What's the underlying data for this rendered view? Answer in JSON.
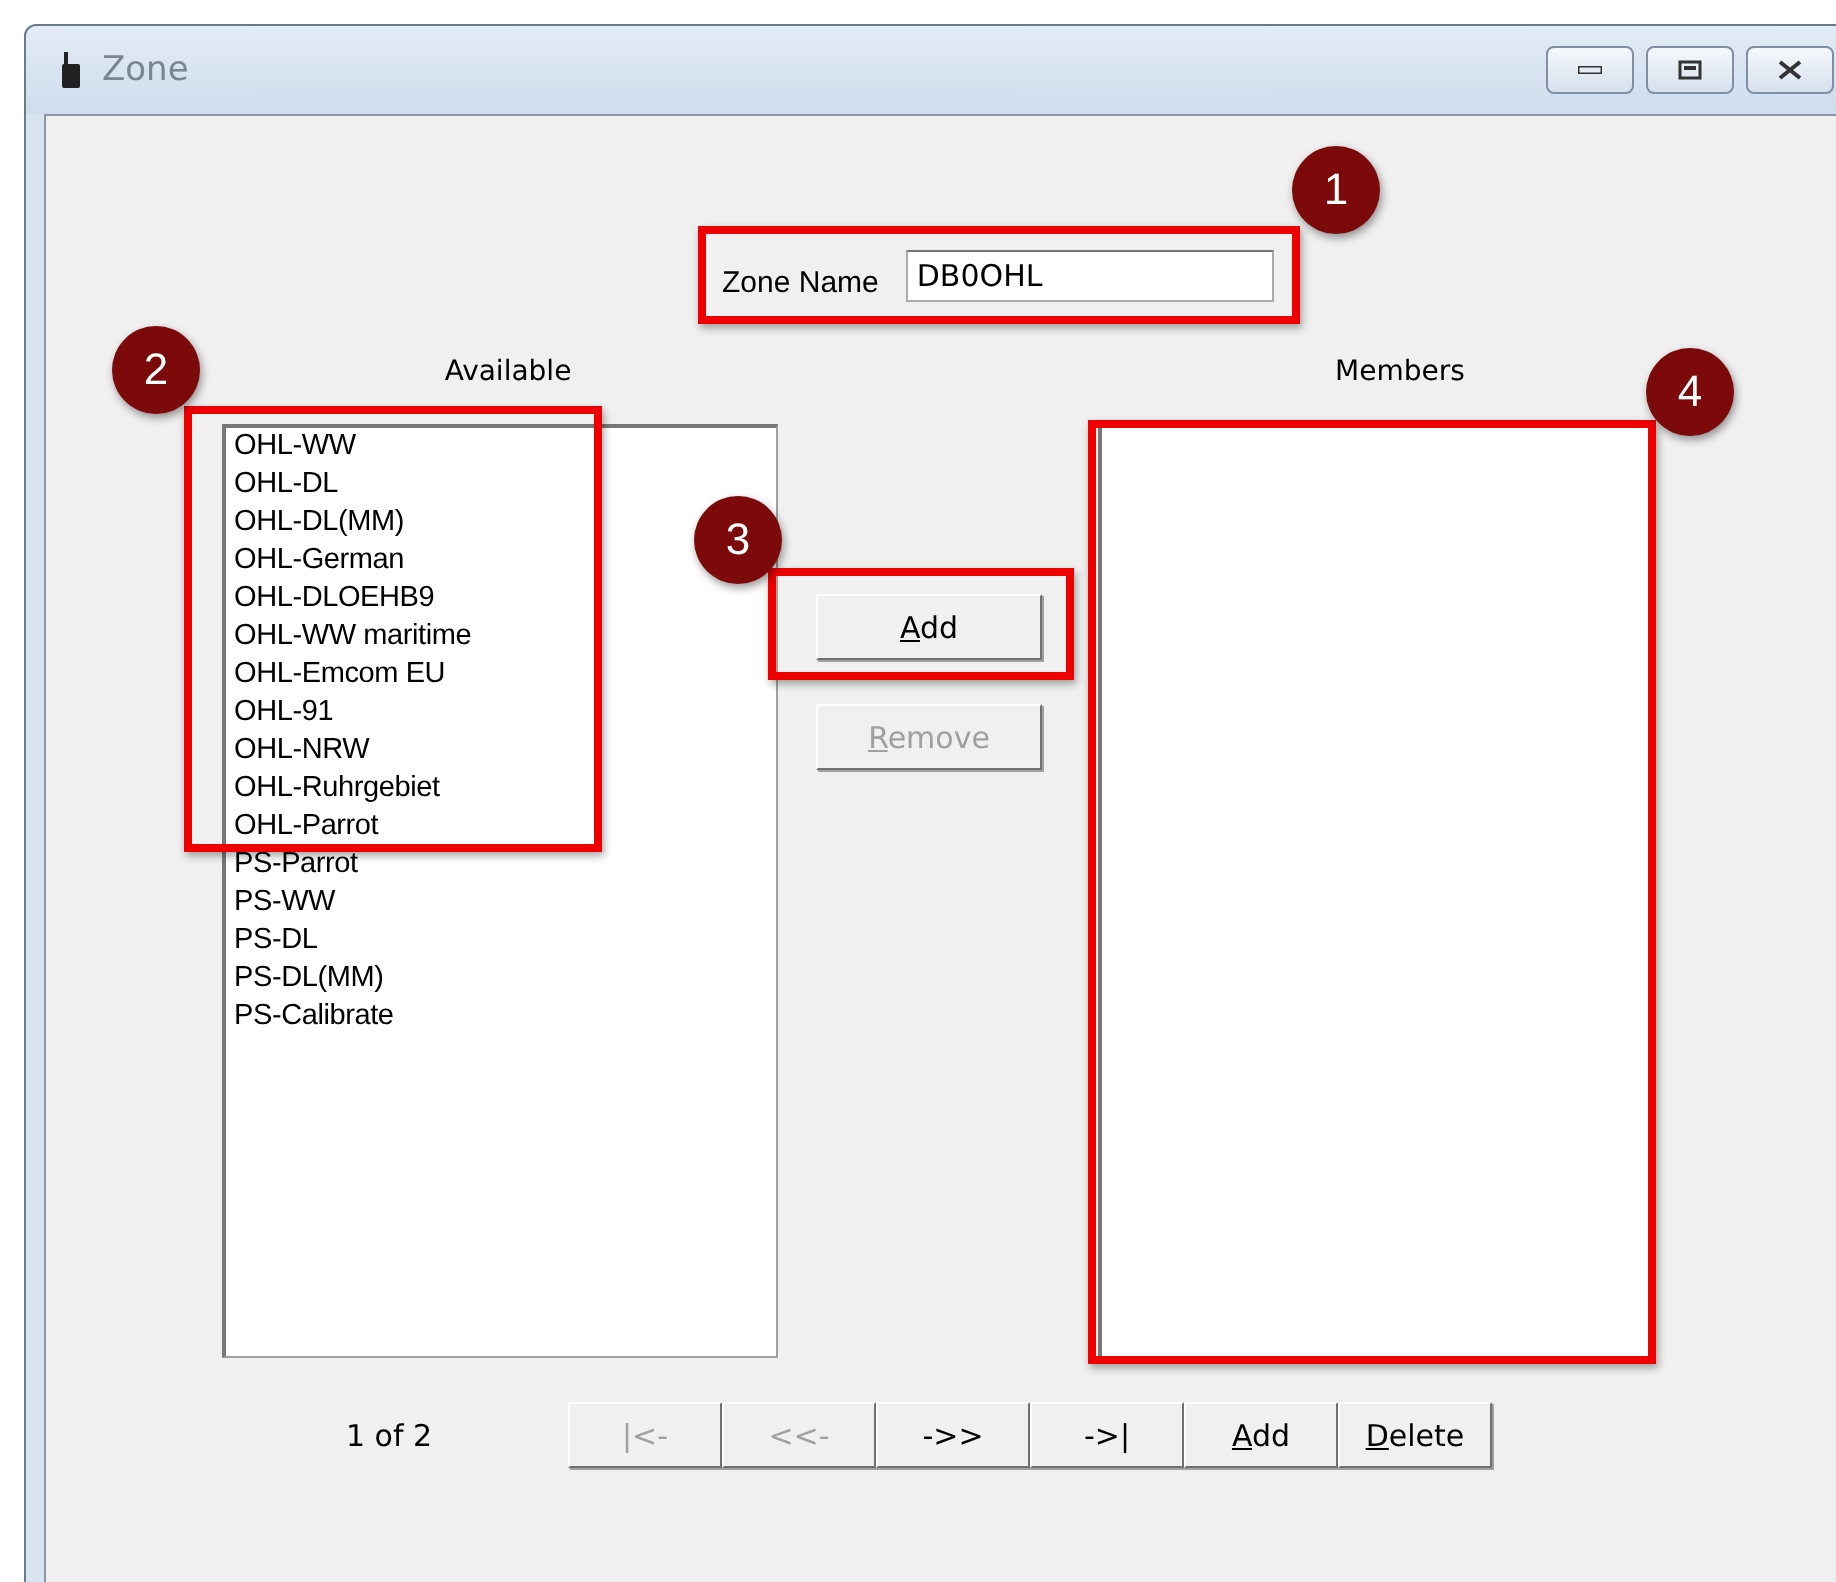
{
  "window": {
    "title": "Zone"
  },
  "zone_name": {
    "label": "Zone Name",
    "value": "DB0OHL"
  },
  "available": {
    "title": "Available",
    "items": [
      "OHL-WW",
      "OHL-DL",
      "OHL-DL(MM)",
      "OHL-German",
      "OHL-DLOEHB9",
      "OHL-WW maritime",
      "OHL-Emcom EU",
      "OHL-91",
      "OHL-NRW",
      "OHL-Ruhrgebiet",
      "OHL-Parrot",
      "PS-Parrot",
      "PS-WW",
      "PS-DL",
      "PS-DL(MM)",
      "PS-Calibrate"
    ]
  },
  "members": {
    "title": "Members"
  },
  "move_buttons": [
    {
      "label": "Add",
      "disabled": false
    },
    {
      "label": "Remove",
      "disabled": true
    }
  ],
  "pager": {
    "text": "1 of 2",
    "buttons": [
      {
        "label": "|<-",
        "disabled": true
      },
      {
        "label": "<<-",
        "disabled": true
      },
      {
        "label": "->>",
        "disabled": false
      },
      {
        "label": "->|",
        "disabled": false
      },
      {
        "label": "Add",
        "disabled": false
      },
      {
        "label": "Delete",
        "disabled": false
      }
    ]
  },
  "annotations": [
    {
      "number": "1"
    },
    {
      "number": "2"
    },
    {
      "number": "3"
    },
    {
      "number": "4"
    }
  ]
}
